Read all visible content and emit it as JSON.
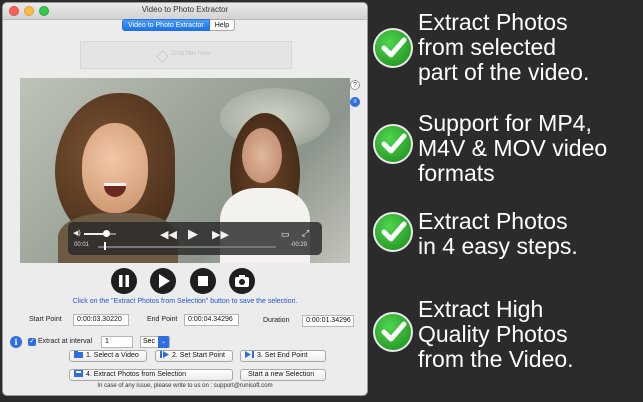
{
  "window": {
    "title": "Video to Photo Extractor",
    "tabs": [
      "Video to Photo Extractor",
      "Help"
    ],
    "dropzone_label": "Drop files here",
    "side_icons": {
      "help": "?",
      "menu": "≡"
    }
  },
  "player": {
    "current_time": "00:01",
    "remaining_time": "-00:29",
    "volume_fraction": 0.7,
    "progress_fraction": 0.03,
    "icons": [
      "volume-icon",
      "skip-back-icon",
      "play-icon",
      "skip-forward-icon",
      "airplay-icon",
      "fullscreen-icon"
    ]
  },
  "controls": [
    "pause-icon",
    "play-icon",
    "stop-icon",
    "camera-icon"
  ],
  "hint": "Click on the \"Extract Photos from Selection\" button to save the selection.",
  "selection": {
    "start_label": "Start Point",
    "start_value": "0:00:03.30220",
    "end_label": "End Point",
    "end_value": "0:00:04.34296",
    "duration_label": "Duration",
    "duration_value": "0:00:01.34296"
  },
  "interval": {
    "label": "Extract at interval",
    "value": "1",
    "unit": "Sec",
    "checked": true
  },
  "buttons": {
    "select_video": "1. Select a Video",
    "set_start": "2. Set Start Point",
    "set_end": "3. Set End Point",
    "extract": "4. Extract Photos from Selection",
    "new_selection": "Start a new Selection"
  },
  "footer": "In case of any issue, please write to us on : support@runisoft.com",
  "features": [
    {
      "lines": [
        "Extract Photos",
        "from selected",
        "part of the video."
      ]
    },
    {
      "lines": [
        "Support for MP4,",
        "M4V & MOV video",
        "formats"
      ]
    },
    {
      "lines": [
        "Extract Photos",
        "in 4 easy steps."
      ]
    },
    {
      "lines": [
        "Extract High",
        "Quality Photos",
        "from the Video."
      ]
    }
  ],
  "colors": {
    "accent": "#2f6de0",
    "check_green": "#2ea82e",
    "background": "#2b2b2b"
  }
}
